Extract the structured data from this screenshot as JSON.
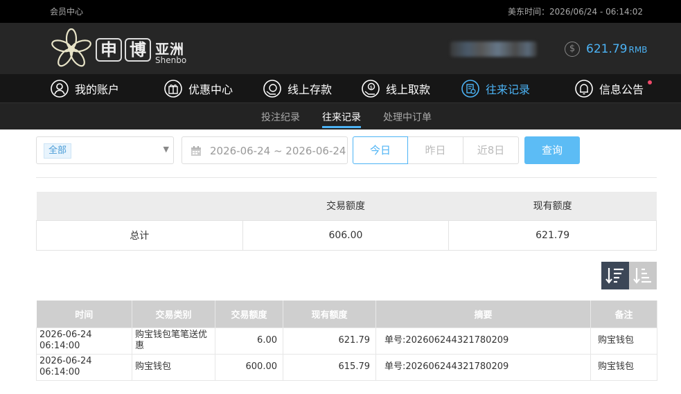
{
  "topbar": {
    "member_center": "会员中心",
    "time_label": "美东时间：",
    "time_value": "2026/06/24 - 06:14:02"
  },
  "brand": {
    "char1": "申",
    "char2": "博",
    "cn_name": "亚洲",
    "en_name": "Shenbo"
  },
  "account": {
    "balance": "621.79",
    "currency": "RMB"
  },
  "main_nav": [
    {
      "label": "我的账户",
      "icon": "user-icon"
    },
    {
      "label": "优惠中心",
      "icon": "gift-icon"
    },
    {
      "label": "线上存款",
      "icon": "deposit-icon"
    },
    {
      "label": "线上取款",
      "icon": "withdraw-icon"
    },
    {
      "label": "往来记录",
      "icon": "records-icon",
      "active": true
    },
    {
      "label": "信息公告",
      "icon": "bell-icon"
    }
  ],
  "sub_nav": [
    {
      "label": "投注纪录"
    },
    {
      "label": "往来记录",
      "active": true
    },
    {
      "label": "处理中订单"
    }
  ],
  "filters": {
    "type_selected": "全部",
    "date_range": "2026-06-24 ~ 2026-06-24",
    "periods": [
      "今日",
      "昨日",
      "近8日"
    ],
    "active_period": "今日",
    "query_label": "查询"
  },
  "summary": {
    "headers": [
      "",
      "交易额度",
      "现有额度"
    ],
    "row_label": "总计",
    "trade_amount": "606.00",
    "current_amount": "621.79"
  },
  "records": {
    "headers": [
      "时间",
      "交易类别",
      "交易额度",
      "现有额度",
      "摘要",
      "备注"
    ],
    "rows": [
      [
        "2026-06-24 06:14:00",
        "购宝钱包笔笔送优惠",
        "6.00",
        "621.79",
        "单号:202606244321780209",
        "购宝钱包"
      ],
      [
        "2026-06-24 06:14:00",
        "购宝钱包",
        "600.00",
        "615.79",
        "单号:202606244321780209",
        "购宝钱包"
      ]
    ]
  },
  "colors": {
    "accent": "#4cb3f5",
    "notification_dot": "#f04a6a"
  }
}
